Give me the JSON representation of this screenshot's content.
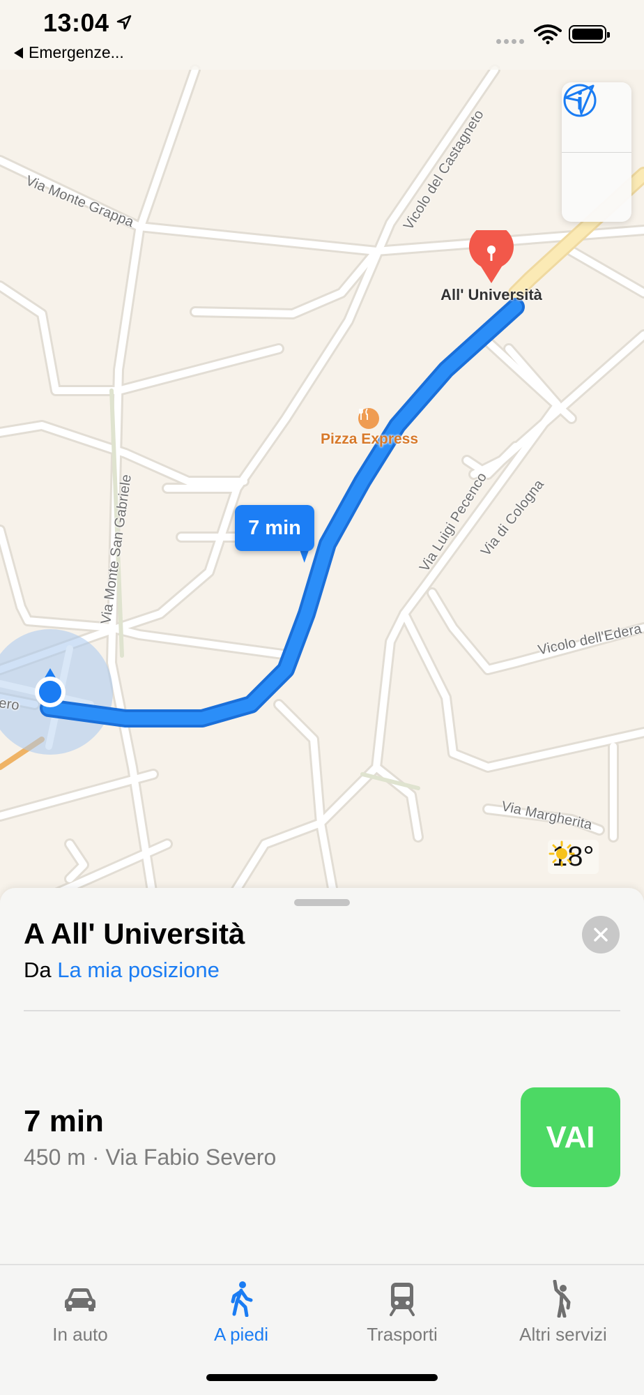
{
  "status_bar": {
    "time": "13:04",
    "back_label": "Emergenze..."
  },
  "map": {
    "streets": [
      "Via Monte Grappa",
      "Vicolo del Castagneto",
      "Via Monte San Gabriele",
      "Via Luigi Pecenco",
      "Via di Cologna",
      "Vicolo dell'Edera",
      "Via Margherita",
      "ero"
    ],
    "destination_label": "All' Università",
    "poi_label": "Pizza Express",
    "route_time": "7 min",
    "weather_temp": "18°",
    "route_color": "#1c7ef5",
    "pin_color": "#f2584a"
  },
  "sheet": {
    "title": "A All' Università",
    "from_prefix": "Da",
    "from_link": "La mia posizione",
    "duration": "7 min",
    "detail": "450 m · Via Fabio Severo",
    "go_label": "VAI",
    "go_color": "#4cd964"
  },
  "tabs": [
    {
      "label": "In auto",
      "icon": "car-icon"
    },
    {
      "label": "A piedi",
      "icon": "walking-icon"
    },
    {
      "label": "Trasporti",
      "icon": "train-icon"
    },
    {
      "label": "Altri servizi",
      "icon": "rideshare-icon"
    }
  ]
}
